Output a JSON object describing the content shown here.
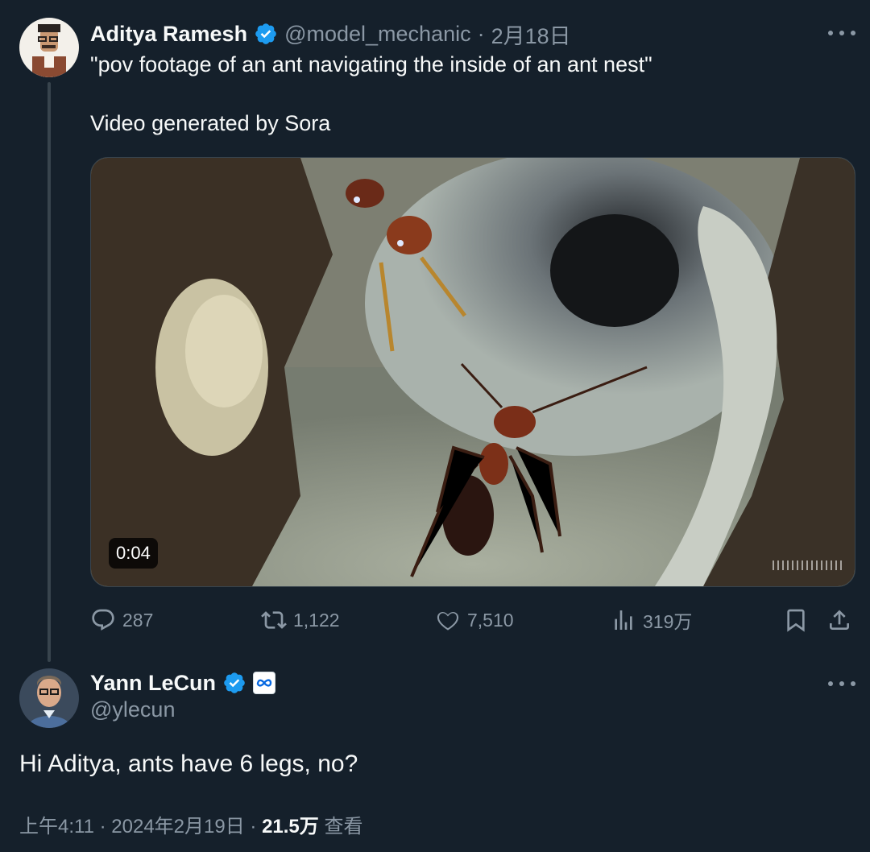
{
  "tweet": {
    "author_name": "Aditya Ramesh",
    "handle": "@model_mechanic",
    "separator": "·",
    "date": "2月18日",
    "text_line1": "\"pov footage of an ant navigating the inside of an ant nest\"",
    "text_line2": "Video generated by Sora",
    "video_duration": "0:04",
    "counts": {
      "replies": "287",
      "retweets": "1,122",
      "likes": "7,510",
      "views": "319万"
    }
  },
  "reply": {
    "author_name": "Yann LeCun",
    "handle": "@ylecun",
    "text": "Hi Aditya, ants have 6 legs, no?",
    "time": "上午4:11",
    "sep": "·",
    "date": "2024年2月19日",
    "views_count": "21.5万",
    "views_label": "查看"
  },
  "colors": {
    "background": "#15202b",
    "text": "#f7f9f9",
    "secondary": "#8b98a5",
    "verified": "#1d9bf0"
  },
  "icons": [
    "verified-badge-icon",
    "more-icon",
    "reply-icon",
    "retweet-icon",
    "like-icon",
    "views-icon",
    "bookmark-icon",
    "share-icon",
    "meta-affiliation-icon"
  ]
}
